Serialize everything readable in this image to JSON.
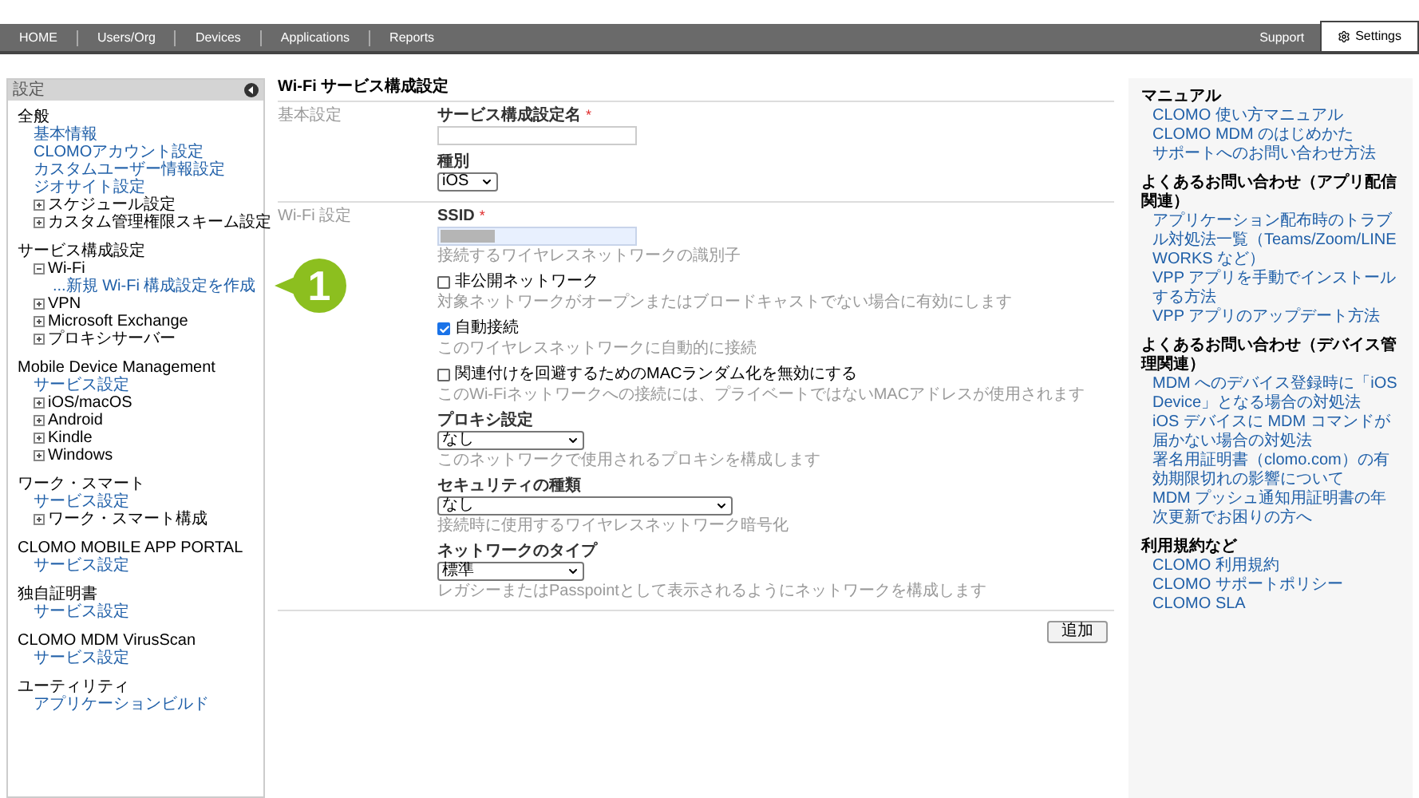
{
  "nav": {
    "tabs": [
      {
        "label": "HOME",
        "selected": false
      },
      {
        "label": "Users/Org",
        "selected": false
      },
      {
        "label": "Devices",
        "selected": false
      },
      {
        "label": "Applications",
        "selected": false
      },
      {
        "label": "Reports",
        "selected": false
      }
    ],
    "right_tabs": [
      {
        "label": "Support",
        "selected": false,
        "kind": "plain"
      },
      {
        "label": "Settings",
        "selected": true,
        "kind": "gear"
      }
    ]
  },
  "sidebar": {
    "title": "設定",
    "sections": [
      {
        "title": "全般",
        "items": [
          {
            "label": "基本情報",
            "kind": "link"
          },
          {
            "label": "CLOMOアカウント設定",
            "kind": "link"
          },
          {
            "label": "カスタムユーザー情報設定",
            "kind": "link"
          },
          {
            "label": "ジオサイト設定",
            "kind": "link"
          },
          {
            "label": "スケジュール設定",
            "kind": "node",
            "expanded": false
          },
          {
            "label": "カスタム管理権限スキーム設定",
            "kind": "node",
            "expanded": false
          }
        ]
      },
      {
        "title": "サービス構成設定",
        "items": [
          {
            "label": "Wi-Fi",
            "kind": "node",
            "expanded": true,
            "children": [
              {
                "label": "...新規 Wi-Fi 構成設定を作成",
                "kind": "link",
                "callout": "1"
              }
            ]
          },
          {
            "label": "VPN",
            "kind": "node",
            "expanded": false
          },
          {
            "label": "Microsoft Exchange",
            "kind": "node",
            "expanded": false
          },
          {
            "label": "プロキシサーバー",
            "kind": "node",
            "expanded": false
          }
        ]
      },
      {
        "title": "Mobile Device Management",
        "items": [
          {
            "label": "サービス設定",
            "kind": "link"
          },
          {
            "label": "iOS/macOS",
            "kind": "node",
            "expanded": false
          },
          {
            "label": "Android",
            "kind": "node",
            "expanded": false
          },
          {
            "label": "Kindle",
            "kind": "node",
            "expanded": false
          },
          {
            "label": "Windows",
            "kind": "node",
            "expanded": false
          }
        ]
      },
      {
        "title": "ワーク・スマート",
        "items": [
          {
            "label": "サービス設定",
            "kind": "link"
          },
          {
            "label": "ワーク・スマート構成",
            "kind": "node",
            "expanded": false
          }
        ]
      },
      {
        "title": "CLOMO MOBILE APP PORTAL",
        "items": [
          {
            "label": "サービス設定",
            "kind": "link"
          }
        ]
      },
      {
        "title": "独自証明書",
        "items": [
          {
            "label": "サービス設定",
            "kind": "link"
          }
        ]
      },
      {
        "title": "CLOMO MDM VirusScan",
        "items": [
          {
            "label": "サービス設定",
            "kind": "link"
          }
        ]
      },
      {
        "title": "ユーティリティ",
        "items": [
          {
            "label": "アプリケーションビルド",
            "kind": "link"
          }
        ]
      }
    ]
  },
  "form": {
    "title": "Wi-Fi サービス構成設定",
    "sections": [
      {
        "label": "基本設定",
        "fields": [
          {
            "kind": "text",
            "label": "サービス構成設定名",
            "required_mark": "*"
          },
          {
            "kind": "select",
            "label": "種別",
            "value": "iOS"
          }
        ]
      },
      {
        "label": "Wi-Fi 設定",
        "fields": [
          {
            "kind": "masked",
            "label": "SSID",
            "required_mark": "*",
            "hint": "接続するワイヤレスネットワークの識別子"
          },
          {
            "kind": "checkbox",
            "label": "非公開ネットワーク",
            "checked": false,
            "hint": "対象ネットワークがオープンまたはブロードキャストでない場合に有効にします"
          },
          {
            "kind": "checkbox",
            "label": "自動接続",
            "checked": true,
            "hint": "このワイヤレスネットワークに自動的に接続"
          },
          {
            "kind": "checkbox",
            "label": "関連付けを回避するためのMACランダム化を無効にする",
            "checked": false,
            "hint": "このWi-Fiネットワークへの接続には、プライベートではないMACアドレスが使用されます"
          },
          {
            "kind": "select",
            "label": "プロキシ設定",
            "value": "なし",
            "hint": "このネットワークで使用されるプロキシを構成します"
          },
          {
            "kind": "select",
            "label": "セキュリティの種類",
            "value": "なし",
            "hint": "接続時に使用するワイヤレスネットワーク暗号化"
          },
          {
            "kind": "select",
            "label": "ネットワークのタイプ",
            "value": "標準",
            "hint": "レガシーまたはPasspointとして表示されるようにネットワークを構成します"
          }
        ]
      }
    ],
    "submit": "追加"
  },
  "help": {
    "sections": [
      {
        "title": "マニュアル",
        "links": [
          "CLOMO 使い方マニュアル",
          "CLOMO MDM のはじめかた",
          "サポートへのお問い合わせ方法"
        ]
      },
      {
        "title": "よくあるお問い合わせ（アプリ配信関連）",
        "links": [
          "アプリケーション配布時のトラブル対処法一覧（Teams/Zoom/LINE WORKS など）",
          "VPP アプリを手動でインストールする方法",
          "VPP アプリのアップデート方法"
        ]
      },
      {
        "title": "よくあるお問い合わせ（デバイス管理関連）",
        "links": [
          "MDM へのデバイス登録時に「iOS Device」となる場合の対処法",
          "iOS デバイスに MDM コマンドが届かない場合の対処法",
          "署名用証明書（clomo.com）の有効期限切れの影響について",
          "MDM プッシュ通知用証明書の年次更新でお困りの方へ"
        ]
      },
      {
        "title": "利用規約など",
        "links": [
          "CLOMO 利用規約",
          "CLOMO サポートポリシー",
          "CLOMO SLA"
        ]
      }
    ]
  }
}
